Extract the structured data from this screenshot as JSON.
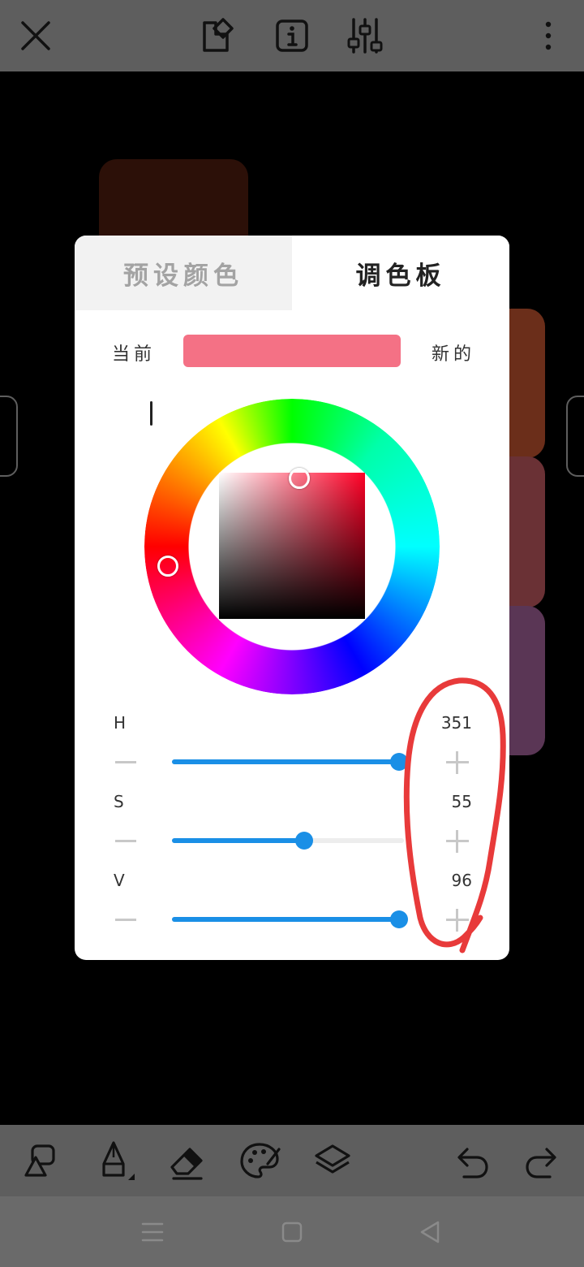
{
  "tabs": {
    "preset": "预设颜色",
    "palette": "调色板"
  },
  "labels": {
    "current": "当前",
    "new": "新的"
  },
  "colors": {
    "current_color": "#f47185",
    "hue_color": "#ff0026",
    "accent": "#1a8fe6",
    "annotation": "#e83a3a"
  },
  "color_wheel": {
    "hue_deg": 351,
    "saturation_pct": 55,
    "value_pct": 96
  },
  "sliders": [
    {
      "label": "H",
      "value": "351",
      "fraction": 0.98
    },
    {
      "label": "S",
      "value": "55",
      "fraction": 0.57
    },
    {
      "label": "V",
      "value": "96",
      "fraction": 0.98
    }
  ],
  "top_bar": {
    "icons": [
      "close-icon",
      "shapes-icon",
      "info-icon",
      "adjust-sliders-icon",
      "more-vertical-icon"
    ]
  },
  "toolbar": {
    "icons": [
      "shapes-tool-icon",
      "pen-icon",
      "eraser-icon",
      "palette-icon",
      "layers-icon",
      "undo-icon",
      "redo-icon"
    ]
  },
  "nav_bar": {
    "icons": [
      "menu-icon",
      "home-icon",
      "back-icon"
    ]
  },
  "canvas_swatches": [
    {
      "color": "#2c1008"
    },
    {
      "color": "#6b2e1a"
    },
    {
      "color": "#6a3135"
    },
    {
      "color": "#5a3655"
    }
  ]
}
